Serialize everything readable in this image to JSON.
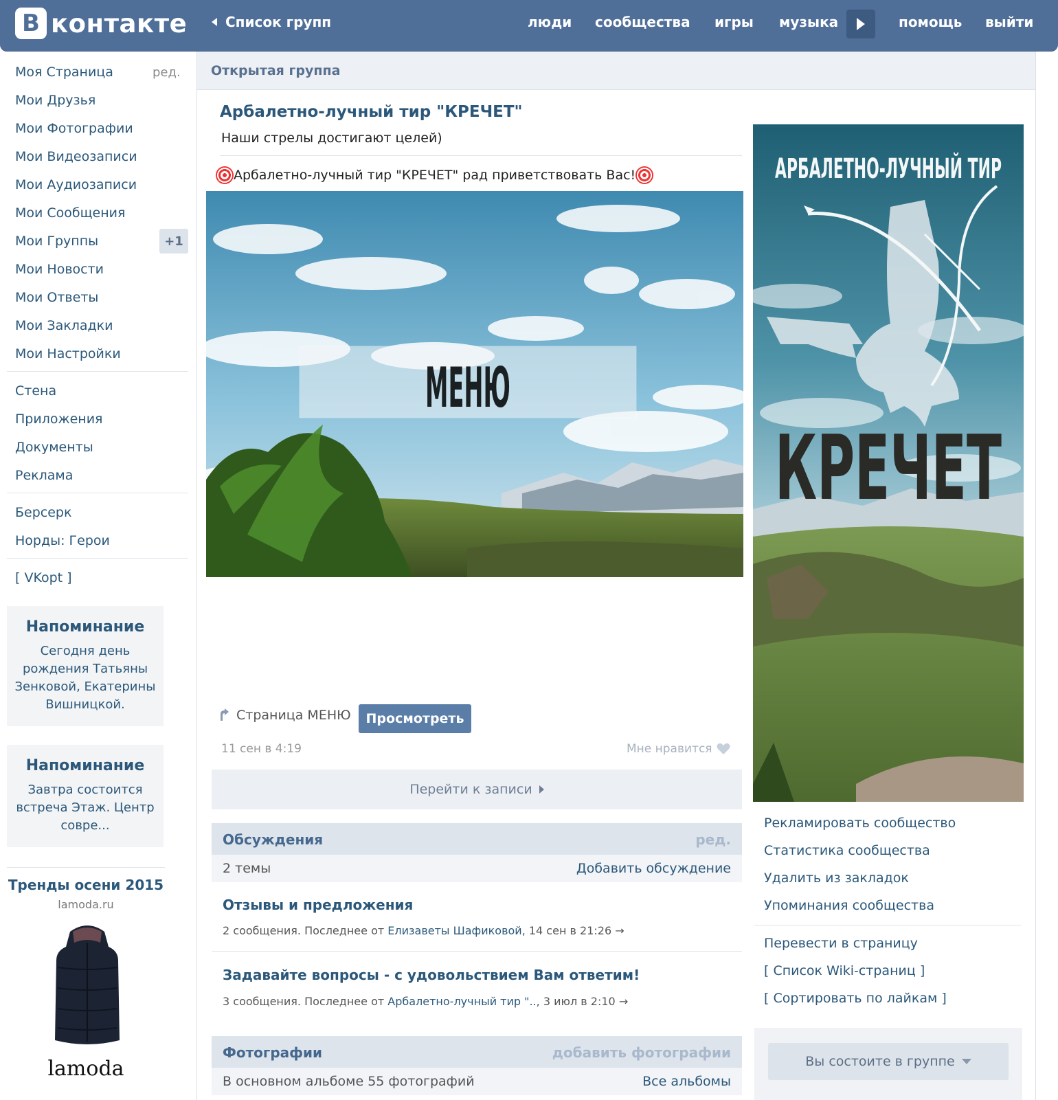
{
  "header": {
    "logo_letter": "В",
    "logo_text": "контакте",
    "back_label": "Список групп",
    "nav": [
      "люди",
      "сообщества",
      "игры",
      "музыка",
      "помощь",
      "выйти"
    ]
  },
  "left_menu": {
    "items": [
      "Моя Страница",
      "Мои Друзья",
      "Мои Фотографии",
      "Мои Видеозаписи",
      "Мои Аудиозаписи",
      "Мои Сообщения",
      "Мои Группы",
      "Мои Новости",
      "Мои Ответы",
      "Мои Закладки",
      "Мои Настройки"
    ],
    "edit_label": "ред.",
    "groups_badge": "+1",
    "apps": [
      "Стена",
      "Приложения",
      "Документы",
      "Реклама"
    ],
    "games": [
      "Берсерк",
      "Норды: Герои"
    ],
    "vkopt": "[ VKopt ]"
  },
  "reminders": [
    {
      "title": "Напоминание",
      "text": "Сегодня день рождения Татьяны Зенковой, Екатерины Вишницкой."
    },
    {
      "title": "Напоминание",
      "text": "Завтра состоится встреча Этаж. Центр совре..."
    }
  ],
  "ad": {
    "title": "Тренды осени 2015",
    "domain": "lamoda.ru",
    "brand": "lamoda"
  },
  "group": {
    "type_label": "Открытая группа",
    "name": "Арбалетно-лучный тир \"КРЕЧЕТ\"",
    "status": "Наши стрелы достигают целей)",
    "welcome": "Арбалетно-лучный тир \"КРЕЧЕТ\" рад приветствовать Вас!",
    "menu_image_text": "МЕНЮ",
    "wiki_page": "Страница МЕНЮ",
    "view_button": "Просмотреть",
    "post_date": "11 сен в 4:19",
    "like_label": "Мне нравится",
    "goto_post": "Перейти к записи"
  },
  "discussions": {
    "title": "Обсуждения",
    "edit": "ред.",
    "count": "2 темы",
    "add": "Добавить обсуждение",
    "topics": [
      {
        "title": "Отзывы и предложения",
        "meta_prefix": "2 сообщения. Последнее от",
        "author": "Елизаветы Шафиковой",
        "meta_suffix": ", 14 сен в 21:26  →"
      },
      {
        "title": "Задавайте вопросы - с удовольствием Вам ответим!",
        "meta_prefix": "3 сообщения. Последнее от",
        "author": "Арбалетно-лучный тир \"..",
        "meta_suffix": ", 3 июл в 2:10  →"
      }
    ]
  },
  "photos": {
    "title": "Фотографии",
    "add": "добавить фотографии",
    "count": "В основном альбоме 55 фотографий",
    "all": "Все альбомы"
  },
  "avatar": {
    "line1": "АРБАЛЕТНО-ЛУЧНЫЙ ТИР",
    "line2": "КРЕЧЕТ"
  },
  "right_actions": [
    "Рекламировать сообщество",
    "Статистика сообщества",
    "Удалить из закладок",
    "Упоминания сообщества"
  ],
  "right_actions2": [
    "Перевести в страницу",
    "[ Список Wiki-страниц ]",
    "[ Сортировать по лайкам ]"
  ],
  "membership": "Вы состоите в группе",
  "colors": {
    "header": "#4f6f99",
    "link": "#2b587a",
    "button": "#5b7ea8"
  }
}
